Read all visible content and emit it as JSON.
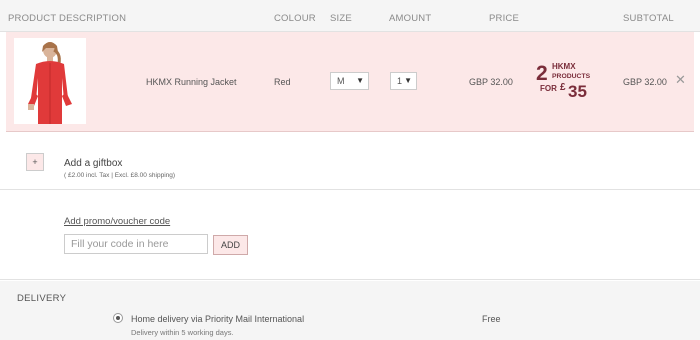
{
  "header": {
    "product_description": "PRODUCT DESCRIPTION",
    "colour": "COLOUR",
    "size": "SIZE",
    "amount": "AMOUNT",
    "price": "PRICE",
    "subtotal": "SUBTOTAL"
  },
  "item": {
    "name": "HKMX Running Jacket",
    "colour": "Red",
    "size": "M",
    "amount": "1",
    "price": "GBP 32.00",
    "subtotal": "GBP 32.00",
    "remove": "✕",
    "jacket_color": "#e03a3a"
  },
  "offer": {
    "big": "2",
    "brand": "HKMX",
    "products": "PRODUCTS",
    "for": "FOR",
    "currency": "£",
    "amount": "35",
    "color": "#7a2d3a"
  },
  "giftbox": {
    "button": "+",
    "title": "Add a giftbox",
    "note": "( £2.00 incl. Tax | Excl. £8.00 shipping)"
  },
  "promo": {
    "link": "Add promo/voucher code",
    "placeholder": "Fill your code in here",
    "button": "ADD"
  },
  "delivery": {
    "title": "DELIVERY",
    "option": "Home delivery via Priority Mail International",
    "sub": "Delivery within 5 working days.",
    "price": "Free"
  }
}
